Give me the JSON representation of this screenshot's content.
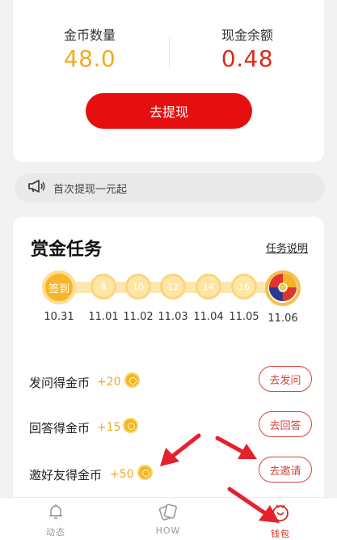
{
  "balance": {
    "coins_label": "金币数量",
    "coins_value": "48.0",
    "cash_label": "现金余额",
    "cash_value": "0.48",
    "withdraw_label": "去提现"
  },
  "notice": {
    "icon": "megaphone-icon",
    "text": "首次提现一元起"
  },
  "tasks": {
    "title": "赏金任务",
    "help_link": "任务说明",
    "checkin": {
      "first_label": "签到",
      "days": [
        {
          "reward": "",
          "date": "10.31"
        },
        {
          "reward": "8",
          "date": "11.01"
        },
        {
          "reward": "10",
          "date": "11.02"
        },
        {
          "reward": "12",
          "date": "11.03"
        },
        {
          "reward": "14",
          "date": "11.04"
        },
        {
          "reward": "16",
          "date": "11.05"
        },
        {
          "reward": "",
          "date": "11.06"
        }
      ],
      "last_icon": "prize-wheel-icon"
    },
    "items": [
      {
        "name": "发问得金币",
        "reward": "+20",
        "button": "去发问"
      },
      {
        "name": "回答得金币",
        "reward": "+15",
        "button": "去回答"
      },
      {
        "name": "邀好友得金币",
        "reward": "+50",
        "button": "去邀请"
      }
    ]
  },
  "nav": {
    "items": [
      {
        "label": "动态",
        "icon": "bell-icon"
      },
      {
        "label": "HOW",
        "icon": "cards-icon"
      },
      {
        "label": "钱包",
        "icon": "wallet-smile-icon"
      }
    ]
  },
  "colors": {
    "accent_red": "#e50f0f",
    "coin_gold": "#f4a91d",
    "cash_red": "#d82b1c",
    "annotation_arrow": "#e5212c"
  }
}
